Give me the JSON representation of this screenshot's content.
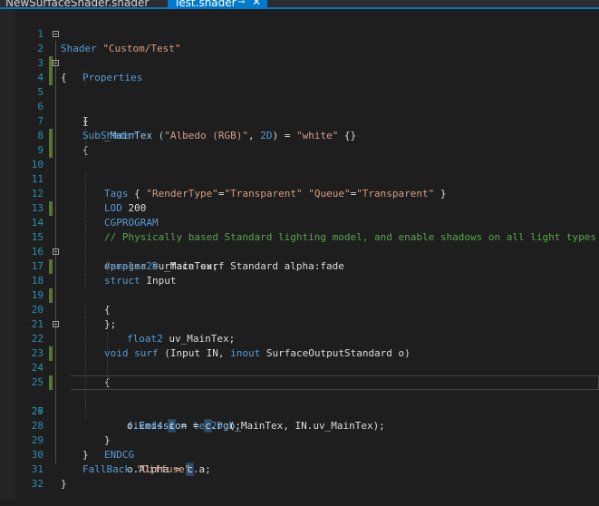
{
  "tabs": [
    {
      "label": "NewSurfaceShader.shader",
      "active": false
    },
    {
      "label": "Test.shader",
      "active": true,
      "pin_glyph": "⊸",
      "close_glyph": "✕"
    }
  ],
  "editor": {
    "accent_color": "#007acc",
    "change_marker_color": "#577430",
    "lines": [
      {
        "n": "1"
      },
      {
        "n": "2"
      },
      {
        "n": "3"
      },
      {
        "n": "4"
      },
      {
        "n": "5"
      },
      {
        "n": "6"
      },
      {
        "n": "7"
      },
      {
        "n": "8"
      },
      {
        "n": "9"
      },
      {
        "n": "10"
      },
      {
        "n": "11"
      },
      {
        "n": "12"
      },
      {
        "n": "13"
      },
      {
        "n": "14"
      },
      {
        "n": "15"
      },
      {
        "n": "16"
      },
      {
        "n": "17"
      },
      {
        "n": "18"
      },
      {
        "n": "19"
      },
      {
        "n": "20"
      },
      {
        "n": "21"
      },
      {
        "n": "22"
      },
      {
        "n": "23"
      },
      {
        "n": "24"
      },
      {
        "n": "25"
      },
      {
        "n": "26"
      },
      {
        "n": "27"
      },
      {
        "n": "28"
      },
      {
        "n": "29"
      },
      {
        "n": "30"
      },
      {
        "n": "31"
      },
      {
        "n": "32"
      }
    ],
    "code": {
      "l1": {
        "a": "Shader ",
        "b": "\"Custom/Test\""
      },
      "l2": {
        "a": "{"
      },
      "l3": {
        "a": "Properties"
      },
      "l4": {
        "a": "{"
      },
      "l5": {
        "a": "_MainTex (",
        "b": "\"Albedo (RGB)\"",
        "c": ", ",
        "d": "2D",
        "e": ") = ",
        "f": "\"white\"",
        "g": " {}"
      },
      "l6": {
        "a": "}"
      },
      "l7": {
        "a": "SubShader"
      },
      "l8": {
        "a": "{"
      },
      "l9": {
        "a": "Tags",
        "b": " { ",
        "c": "\"RenderType\"",
        "d": "=",
        "e": "\"Transparent\"",
        "f": " ",
        "g": "\"Queue\"",
        "h": "=",
        "i": "\"Transparent\"",
        "j": " }"
      },
      "l10": {
        "a": "LOD",
        "b": " 200"
      },
      "l12": {
        "a": "CGPROGRAM"
      },
      "l13": {
        "a": "// Physically based Standard lighting model, and enable shadows on all light types"
      },
      "l14": {
        "a": "#pragma",
        "b": " surface surf Standard alpha:fade"
      },
      "l15": {
        "a": "sampler2D",
        "b": " _MainTex;"
      },
      "l16": {
        "a": "struct",
        "b": " Input"
      },
      "l17": {
        "a": "{"
      },
      "l18": {
        "a": "float2",
        "b": " uv_MainTex;"
      },
      "l19": {
        "a": "};"
      },
      "l21": {
        "a": "void",
        "b": " ",
        "c": "surf",
        "d": " (Input IN, ",
        "e": "inout",
        "f": " SurfaceOutputStandard o)"
      },
      "l22": {
        "a": "{"
      },
      "l24": {
        "a": "fixed4",
        "b": " ",
        "c": "c",
        "d": " = ",
        "e": "tex2D",
        "f": " (_MainTex, IN.uv_MainTex);"
      },
      "l25": {
        "a": "o.",
        "b": "Emission",
        "c": " = ",
        "d": "c",
        "e": ".",
        "f": "rgb",
        "g": ";"
      },
      "l26": {
        "a": "o.Alpha = ",
        "b": "c",
        "c": ".a;"
      },
      "l27": {
        "a": "}"
      },
      "l28": {
        "a": "ENDCG"
      },
      "l29": {
        "a": "}"
      },
      "l30": {
        "a": "FallBack",
        "b": " ",
        "c": "\"Diffuse\""
      },
      "l31": {
        "a": "}"
      }
    }
  }
}
